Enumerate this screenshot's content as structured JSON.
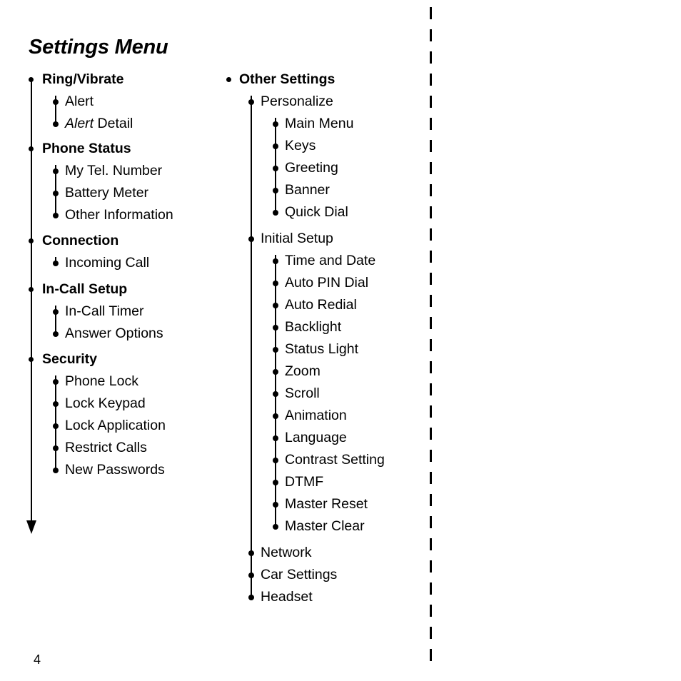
{
  "document": {
    "title": "Settings Menu",
    "page_number": "4"
  },
  "tree": {
    "left_column": [
      {
        "label": "Ring/Vibrate",
        "level": 1,
        "children": [
          {
            "label": "Alert",
            "level": 2
          },
          {
            "label": "Alert Detail",
            "level": 2,
            "italic_prefix": "Alert",
            "plain_suffix": " Detail"
          }
        ]
      },
      {
        "label": "Phone Status",
        "level": 1,
        "children": [
          {
            "label": "My Tel. Number",
            "level": 2
          },
          {
            "label": "Battery Meter",
            "level": 2
          },
          {
            "label": "Other Information",
            "level": 2
          }
        ]
      },
      {
        "label": "Connection",
        "level": 1,
        "children": [
          {
            "label": "Incoming Call",
            "level": 2
          }
        ]
      },
      {
        "label": "In-Call Setup",
        "level": 1,
        "children": [
          {
            "label": "In-Call Timer",
            "level": 2
          },
          {
            "label": "Answer Options",
            "level": 2
          }
        ]
      },
      {
        "label": "Security",
        "level": 1,
        "children": [
          {
            "label": "Phone Lock",
            "level": 2
          },
          {
            "label": "Lock Keypad",
            "level": 2
          },
          {
            "label": "Lock Application",
            "level": 2
          },
          {
            "label": "Restrict Calls",
            "level": 2
          },
          {
            "label": "New Passwords",
            "level": 2
          }
        ]
      }
    ],
    "right_column": [
      {
        "label": "Other Settings",
        "level": 1,
        "children": [
          {
            "label": "Personalize",
            "level": 2,
            "children": [
              {
                "label": "Main Menu",
                "level": 3
              },
              {
                "label": "Keys",
                "level": 3
              },
              {
                "label": "Greeting",
                "level": 3
              },
              {
                "label": "Banner",
                "level": 3
              },
              {
                "label": "Quick Dial",
                "level": 3
              }
            ]
          },
          {
            "label": "Initial Setup",
            "level": 2,
            "children": [
              {
                "label": "Time and Date",
                "level": 3
              },
              {
                "label": "Auto PIN Dial",
                "level": 3
              },
              {
                "label": "Auto Redial",
                "level": 3
              },
              {
                "label": "Backlight",
                "level": 3
              },
              {
                "label": "Status Light",
                "level": 3
              },
              {
                "label": "Zoom",
                "level": 3
              },
              {
                "label": "Scroll",
                "level": 3
              },
              {
                "label": "Animation",
                "level": 3
              },
              {
                "label": "Language",
                "level": 3
              },
              {
                "label": "Contrast Setting",
                "level": 3
              },
              {
                "label": "DTMF",
                "level": 3
              },
              {
                "label": "Master Reset",
                "level": 3
              },
              {
                "label": "Master Clear",
                "level": 3
              }
            ]
          },
          {
            "label": "Network",
            "level": 2
          },
          {
            "label": "Car Settings",
            "level": 2
          },
          {
            "label": "Headset",
            "level": 2
          }
        ]
      }
    ]
  },
  "decorations": {
    "left_column_flow_arrow": "down-arrow",
    "margin_rule": "vertical-dashed-rule"
  },
  "colors": {
    "text": "#000000",
    "background": "#ffffff",
    "rule": "#000000"
  }
}
